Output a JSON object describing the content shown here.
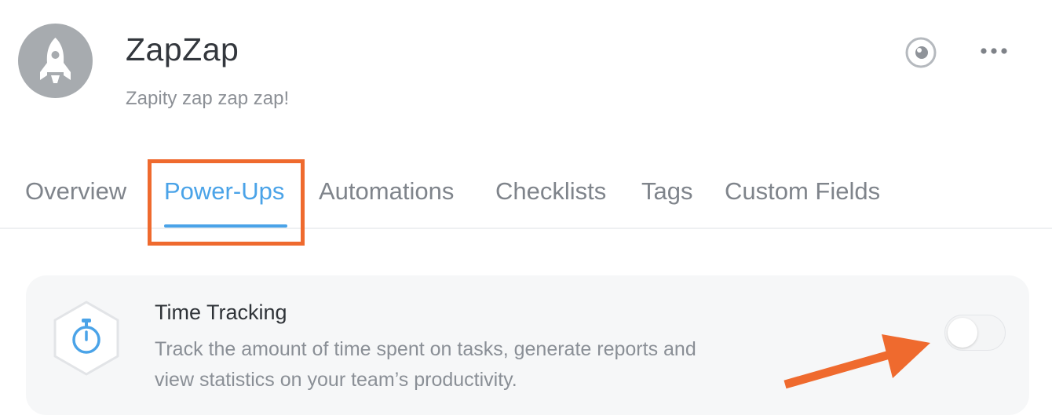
{
  "header": {
    "title": "ZapZap",
    "subtitle": "Zapity zap zap zap!",
    "avatar_icon": "rocket-icon",
    "actions": [
      {
        "name": "watch",
        "icon": "eye-icon"
      },
      {
        "name": "more",
        "icon": "more-horizontal-icon"
      }
    ]
  },
  "tabs": [
    {
      "label": "Overview",
      "active": false
    },
    {
      "label": "Power-Ups",
      "active": true
    },
    {
      "label": "Automations",
      "active": false
    },
    {
      "label": "Checklists",
      "active": false
    },
    {
      "label": "Tags",
      "active": false
    },
    {
      "label": "Custom Fields",
      "active": false
    }
  ],
  "powerup": {
    "title": "Time Tracking",
    "description_line1": "Track the amount of time spent on tasks, generate reports and",
    "description_line2": "view statistics on your team’s productivity.",
    "icon": "stopwatch-icon",
    "enabled": false
  },
  "annotations": {
    "highlight": "tab-power-ups",
    "arrow_target": "time-tracking-toggle",
    "color": "#ef6a2e"
  },
  "colors": {
    "accent": "#4aa3e8",
    "annotation": "#ef6a2e"
  }
}
